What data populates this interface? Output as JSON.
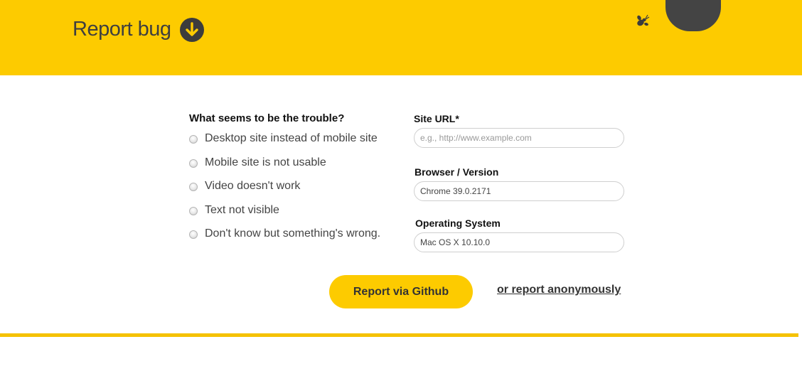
{
  "header": {
    "title": "Report bug",
    "accent_color": "#fdcb00",
    "icons": {
      "action": "arrow-down-circle-icon",
      "brand": "bug-icon"
    }
  },
  "form": {
    "question": "What seems to be the trouble?",
    "options": [
      {
        "label": "Desktop site instead of mobile site",
        "selected": false
      },
      {
        "label": "Mobile site is not usable",
        "selected": false
      },
      {
        "label": "Video doesn't work",
        "selected": false
      },
      {
        "label": "Text not visible",
        "selected": false
      },
      {
        "label": "Don't know but something's wrong.",
        "selected": false
      }
    ],
    "site_url": {
      "label": "Site URL*",
      "value": "",
      "placeholder": "e.g., http://www.example.com"
    },
    "browser": {
      "label": "Browser / Version",
      "value": "Chrome 39.0.2171",
      "placeholder": ""
    },
    "os": {
      "label": "Operating System",
      "value": "Mac OS X 10.10.0",
      "placeholder": ""
    },
    "submit_label": "Report via Github",
    "anonymous_label": "or report anonymously"
  }
}
